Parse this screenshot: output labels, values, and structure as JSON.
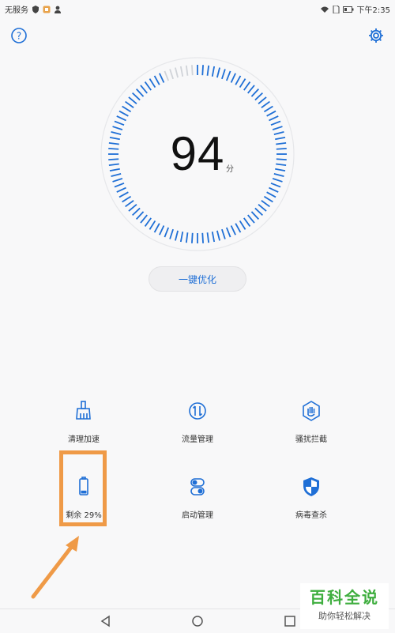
{
  "status_bar": {
    "carrier": "无服务",
    "time": "下午2:35"
  },
  "score": {
    "value": "94",
    "unit": "分"
  },
  "optimize_button": "一键优化",
  "features": [
    {
      "label": "清理加速",
      "icon": "broom-icon"
    },
    {
      "label": "流量管理",
      "icon": "data-traffic-icon"
    },
    {
      "label": "骚扰拦截",
      "icon": "hand-block-icon"
    },
    {
      "label": "剩余 29%",
      "icon": "battery-icon",
      "battery_level": 0.29
    },
    {
      "label": "启动管理",
      "icon": "toggle-icon"
    },
    {
      "label": "病毒查杀",
      "icon": "shield-icon"
    }
  ],
  "nav": [
    "back-icon",
    "home-icon",
    "recents-icon"
  ],
  "watermark": {
    "main": "百科全说",
    "sub": "助你轻松解决"
  },
  "colors": {
    "accent": "#1f6fd6",
    "tick_light": "#d0d3d8",
    "highlight": "#ef9a47",
    "watermark": "#3fae3f"
  }
}
